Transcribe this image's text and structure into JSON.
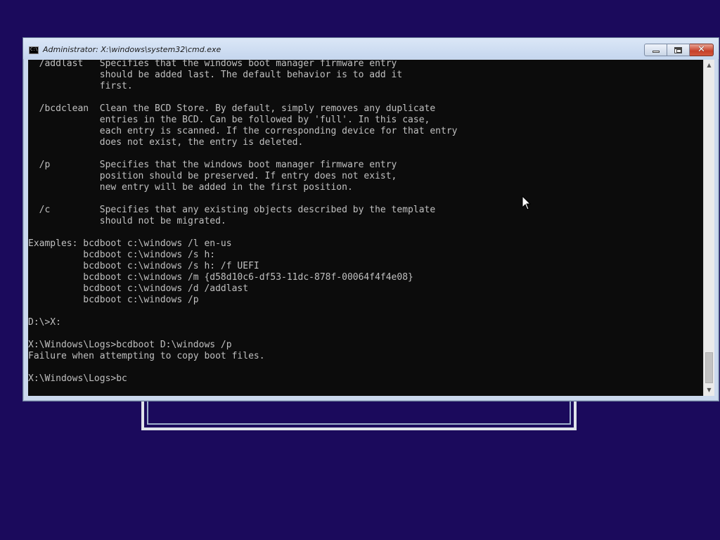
{
  "window": {
    "title": "Administrator: X:\\windows\\system32\\cmd.exe",
    "icon_text": "C:\\",
    "buttons": {
      "minimize": "minimize",
      "maximize": "maximize",
      "close": "✕"
    }
  },
  "console": {
    "lines": [
      "  /addlast   Specifies that the windows boot manager firmware entry",
      "             should be added last. The default behavior is to add it",
      "             first.",
      "",
      "  /bcdclean  Clean the BCD Store. By default, simply removes any duplicate",
      "             entries in the BCD. Can be followed by 'full'. In this case,",
      "             each entry is scanned. If the corresponding device for that entry",
      "             does not exist, the entry is deleted.",
      "",
      "  /p         Specifies that the windows boot manager firmware entry",
      "             position should be preserved. If entry does not exist,",
      "             new entry will be added in the first position.",
      "",
      "  /c         Specifies that any existing objects described by the template",
      "             should not be migrated.",
      "",
      "Examples: bcdboot c:\\windows /l en-us",
      "          bcdboot c:\\windows /s h:",
      "          bcdboot c:\\windows /s h: /f UEFI",
      "          bcdboot c:\\windows /m {d58d10c6-df53-11dc-878f-00064f4f4e08}",
      "          bcdboot c:\\windows /d /addlast",
      "          bcdboot c:\\windows /p",
      "",
      "D:\\>X:",
      "",
      "X:\\Windows\\Logs>bcdboot D:\\windows /p",
      "Failure when attempting to copy boot files.",
      "",
      "X:\\Windows\\Logs>bc"
    ]
  },
  "scrollbar": {
    "up_arrow": "▲",
    "down_arrow": "▼"
  },
  "colors": {
    "desktop": "#1b0a5c",
    "console_bg": "#0c0c0c",
    "console_fg": "#c0c0c0",
    "close_button": "#c7402a"
  }
}
